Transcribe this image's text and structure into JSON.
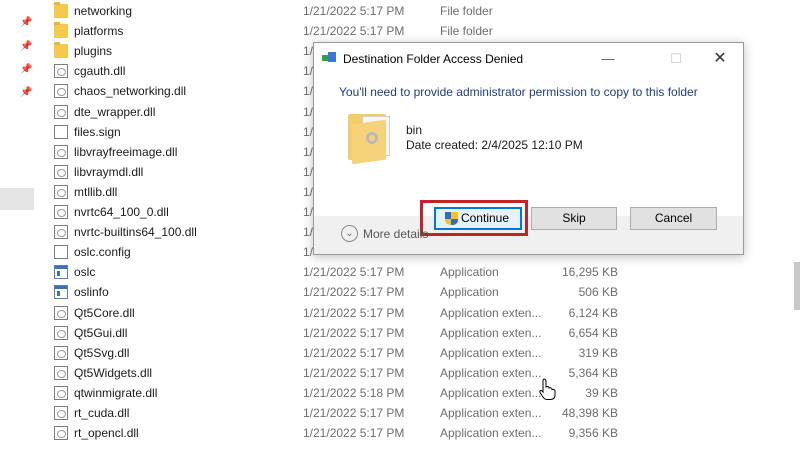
{
  "files": [
    {
      "name": "networking",
      "date": "1/21/2022 5:17 PM",
      "type": "File folder",
      "size": "",
      "icon": "folder"
    },
    {
      "name": "platforms",
      "date": "1/21/2022 5:17 PM",
      "type": "File folder",
      "size": "",
      "icon": "folder"
    },
    {
      "name": "plugins",
      "date": "1/",
      "type": "",
      "size": "",
      "icon": "folder"
    },
    {
      "name": "cgauth.dll",
      "date": "1/",
      "type": "",
      "size": "",
      "icon": "dll"
    },
    {
      "name": "chaos_networking.dll",
      "date": "1/",
      "type": "",
      "size": "",
      "icon": "dll"
    },
    {
      "name": "dte_wrapper.dll",
      "date": "1/",
      "type": "",
      "size": "",
      "icon": "dll"
    },
    {
      "name": "files.sign",
      "date": "1/",
      "type": "",
      "size": "",
      "icon": "doc"
    },
    {
      "name": "libvrayfreeimage.dll",
      "date": "1/",
      "type": "",
      "size": "",
      "icon": "dll"
    },
    {
      "name": "libvraymdl.dll",
      "date": "1/",
      "type": "",
      "size": "",
      "icon": "dll"
    },
    {
      "name": "mtllib.dll",
      "date": "1/",
      "type": "",
      "size": "",
      "icon": "dll"
    },
    {
      "name": "nvrtc64_100_0.dll",
      "date": "1/",
      "type": "",
      "size": "",
      "icon": "dll"
    },
    {
      "name": "nvrtc-builtins64_100.dll",
      "date": "1/",
      "type": "",
      "size": "",
      "icon": "dll"
    },
    {
      "name": "oslc.config",
      "date": "1/",
      "type": "",
      "size": "",
      "icon": "doc"
    },
    {
      "name": "oslc",
      "date": "1/21/2022 5:17 PM",
      "type": "Application",
      "size": "16,295 KB",
      "icon": "app"
    },
    {
      "name": "oslinfo",
      "date": "1/21/2022 5:17 PM",
      "type": "Application",
      "size": "506 KB",
      "icon": "app"
    },
    {
      "name": "Qt5Core.dll",
      "date": "1/21/2022 5:17 PM",
      "type": "Application exten...",
      "size": "6,124 KB",
      "icon": "dll"
    },
    {
      "name": "Qt5Gui.dll",
      "date": "1/21/2022 5:17 PM",
      "type": "Application exten...",
      "size": "6,654 KB",
      "icon": "dll"
    },
    {
      "name": "Qt5Svg.dll",
      "date": "1/21/2022 5:17 PM",
      "type": "Application exten...",
      "size": "319 KB",
      "icon": "dll"
    },
    {
      "name": "Qt5Widgets.dll",
      "date": "1/21/2022 5:17 PM",
      "type": "Application exten...",
      "size": "5,364 KB",
      "icon": "dll"
    },
    {
      "name": "qtwinmigrate.dll",
      "date": "1/21/2022 5:18 PM",
      "type": "Application exten...",
      "size": "39 KB",
      "icon": "dll"
    },
    {
      "name": "rt_cuda.dll",
      "date": "1/21/2022 5:17 PM",
      "type": "Application exten...",
      "size": "48,398 KB",
      "icon": "dll"
    },
    {
      "name": "rt_opencl.dll",
      "date": "1/21/2022 5:17 PM",
      "type": "Application exten...",
      "size": "9,356 KB",
      "icon": "dll"
    }
  ],
  "dialog": {
    "title": "Destination Folder Access Denied",
    "minimize_glyph": "—",
    "maximize_glyph": "☐",
    "close_glyph": "✕",
    "message": "You'll need to provide administrator permission to copy to this folder",
    "item_name": "bin",
    "item_date": "Date created: 2/4/2025 12:10 PM",
    "continue_label": "Continue",
    "skip_label": "Skip",
    "cancel_label": "Cancel",
    "more_details_label": "More details",
    "highlight_color": "#c8202a"
  },
  "colors": {
    "accent": "#0078d7",
    "folder": "#f3c94e",
    "message_text": "#1c3b8a"
  }
}
